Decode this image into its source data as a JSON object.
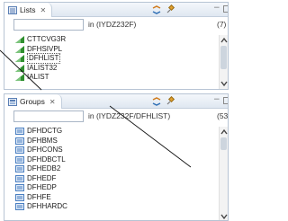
{
  "lists_panel": {
    "tab_label": "Lists",
    "close_glyph": "✕",
    "filter_value": "",
    "filter_scope": "in (IYDZ232F)",
    "count": "(7)",
    "rows": [
      {
        "label": "CTTCVG3R",
        "icon": "list-object-icon"
      },
      {
        "label": "DFHSIVPL",
        "icon": "list-object-icon"
      },
      {
        "label": "DFHLIST",
        "icon": "list-object-icon",
        "selected": true
      },
      {
        "label": "IALIST32",
        "icon": "list-object-icon"
      },
      {
        "label": "IALIST",
        "icon": "list-object-icon"
      }
    ]
  },
  "groups_panel": {
    "tab_label": "Groups",
    "close_glyph": "✕",
    "filter_value": "",
    "filter_scope": "in (IYDZ232F/DFHLIST)",
    "count": "(53)",
    "rows": [
      {
        "label": "DFHDCTG",
        "icon": "group-object-icon"
      },
      {
        "label": "DFHBMS",
        "icon": "group-object-icon"
      },
      {
        "label": "DFHCONS",
        "icon": "group-object-icon"
      },
      {
        "label": "DFHDBCTL",
        "icon": "group-object-icon"
      },
      {
        "label": "DFHEDB2",
        "icon": "group-object-icon"
      },
      {
        "label": "DFHEDF",
        "icon": "group-object-icon"
      },
      {
        "label": "DFHEDP",
        "icon": "group-object-icon"
      },
      {
        "label": "DFHFE",
        "icon": "group-object-icon"
      },
      {
        "label": "DFHHARDC",
        "icon": "group-object-icon"
      }
    ]
  },
  "colors": {
    "panel_border": "#b7c4d4",
    "list_icon_green": "#2f8f2f",
    "group_icon_blue": "#4a7fc1",
    "callout_line": "#111111"
  }
}
